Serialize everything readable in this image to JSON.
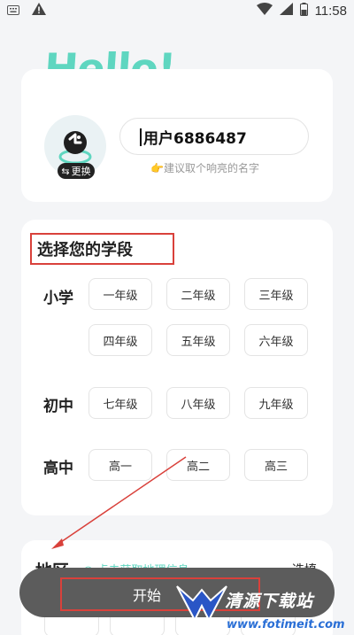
{
  "status_bar": {
    "time": "11:58",
    "icons": [
      "keyboard-icon",
      "warning-icon",
      "wifi-icon",
      "signal-icon",
      "battery-icon"
    ]
  },
  "greeting": "Hello!",
  "profile": {
    "change_label": "更换",
    "username": "用户6886487",
    "hint": "建议取个响亮的名字"
  },
  "grade_section": {
    "title": "选择您的学段",
    "levels": [
      {
        "label": "小学",
        "grades": [
          "一年级",
          "二年级",
          "三年级",
          "四年级",
          "五年级",
          "六年级"
        ]
      },
      {
        "label": "初中",
        "grades": [
          "七年级",
          "八年级",
          "九年级"
        ]
      },
      {
        "label": "高中",
        "grades": [
          "高一",
          "高二",
          "高三"
        ]
      }
    ]
  },
  "region_section": {
    "title": "地区",
    "locate": "点击获取地理信息",
    "select": "选填"
  },
  "start_button": {
    "label": "开始"
  },
  "watermark": {
    "title": "清源下载站",
    "url": "www.fotimeit.com"
  },
  "colors": {
    "accent": "#5fd6c0",
    "annotation": "#d9413b",
    "start_bar": "#5c5c5c"
  }
}
